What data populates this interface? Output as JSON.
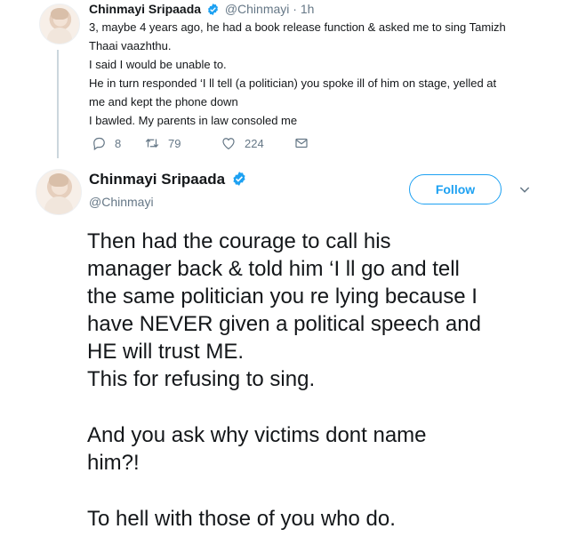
{
  "tweet1": {
    "author_name": "Chinmayi Sripaada",
    "handle_time": "@Chinmayi · 1h",
    "lines": [
      "3, maybe 4 years ago, he had a book release function & asked me to sing Tamizh",
      "Thaai vaazhthu.",
      "I said I would be unable to.",
      "He in turn responded ‘I ll tell (a politician) you spoke ill of him on stage, yelled at",
      "me and kept the phone down",
      "I bawled. My parents in law consoled me"
    ],
    "actions": {
      "reply_count": "8",
      "retweet_count": "79",
      "like_count": "224"
    }
  },
  "tweet2": {
    "author_name": "Chinmayi Sripaada",
    "handle": "@Chinmayi",
    "follow_label": "Follow",
    "lines": [
      "Then had the courage to call his",
      "manager back & told him ‘I ll go and tell",
      "the same politician you re lying because I",
      "have NEVER given a political speech and",
      "HE will trust ME.",
      "This for refusing to sing.",
      "",
      "And you ask why victims dont name",
      "him?!",
      "",
      "To hell with those of you who do."
    ]
  },
  "icons": {
    "verified": "verified-badge-icon",
    "reply": "reply-icon",
    "retweet": "retweet-icon",
    "like": "heart-icon",
    "dm": "envelope-icon",
    "more": "chevron-down-icon"
  },
  "colors": {
    "accent": "#1da1f2",
    "muted": "#657786",
    "text": "#14171a",
    "thread_line": "#ccd6dd"
  }
}
